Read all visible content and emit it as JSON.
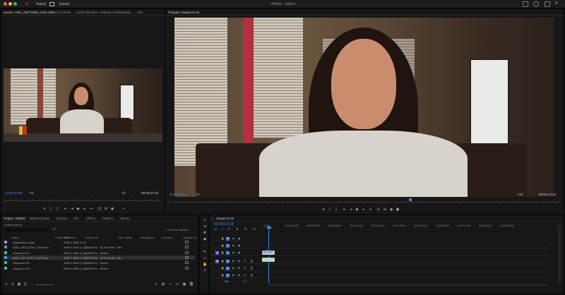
{
  "titlebar": {
    "title": "Untitled - Edited",
    "tabs": [
      "Import",
      "Export"
    ]
  },
  "source_panel": {
    "tabs": [
      "Source: A001_0927(1036_C043.mov",
      "Effect Controls",
      "Audio Clip Mixer: Sequence 04",
      "Metadata",
      "Text"
    ],
    "timecode_left": "13:59:20:09",
    "fit": "Fit",
    "quality": "1/4",
    "duration": "00:00:14:13"
  },
  "program_panel": {
    "tabs": [
      "Program: Sequence 04"
    ],
    "timecode_left": "00:00:14:13",
    "fit": "Fit",
    "quality": "Full",
    "duration": "00:00:14:13"
  },
  "project_panel": {
    "tabs": [
      "Project: Untitled",
      "Media Browser",
      "Libraries",
      "Info",
      "Effects",
      "Markers",
      "History"
    ],
    "project_name": "Untitled.prproj",
    "selection_info": "1 of 6 items selected",
    "columns": [
      "Name",
      "Frame Rate",
      "Video Info",
      "Audio Info",
      "Tape Name",
      "Description",
      "Log Note",
      "Capture Se"
    ],
    "rows": [
      {
        "name": "Adjustment Layer",
        "rate": "",
        "video": "4096 x 4802 (1.0)",
        "audio": "",
        "color": "#c58ee0"
      },
      {
        "name": "A001_0927(1036_C043.mov",
        "rate": "",
        "video": "4096 x 4802 (1.0)",
        "audio": "48000 Hz - 32 bit Float - Ster",
        "color": "#3aa0ff"
      },
      {
        "name": "Sequence 03",
        "rate": "",
        "video": "4096 x 4802 (1.0)",
        "audio": "48000 Hz - Stereo",
        "color": "#4fc38a"
      },
      {
        "name": "A001_0927(1037_C043.mov",
        "rate": "",
        "video": "4096 x 4802 (1.0)",
        "audio": "48000 Hz - 32 bit Float - Ster",
        "color": "#3aa0ff"
      },
      {
        "name": "Sequence 04",
        "rate": "",
        "video": "4096 x 4802 (1.0)",
        "audio": "48000 Hz - Stereo",
        "color": "#4fc38a"
      },
      {
        "name": "Sequence 05",
        "rate": "",
        "video": "4096 x 4802 (1.0)",
        "audio": "48000 Hz - Stereo",
        "color": "#4fc38a"
      }
    ],
    "selected_index": 3
  },
  "timeline": {
    "tab": "Sequence 04",
    "timecode": "00:00:14:13",
    "ticks": [
      "00:00",
      "00:00:16:00",
      "00:00:32:00",
      "00:00:48:00",
      "00:01:04:00",
      "00:01:20:00",
      "00:01:36:00",
      "00:01:52:00",
      "00:02:08:00",
      "00:02:24:00",
      "00:02:40:00",
      "00:02:56:00"
    ],
    "video_tracks": [
      "V3",
      "V2",
      "V1"
    ],
    "audio_tracks": [
      "A1",
      "A2",
      "A3"
    ],
    "source_patch": [
      "V1",
      "A1"
    ],
    "clip_video_label": "A001_0927",
    "clip_audio_label": "",
    "mix_label": "Mix",
    "mix_value": "0.0"
  }
}
